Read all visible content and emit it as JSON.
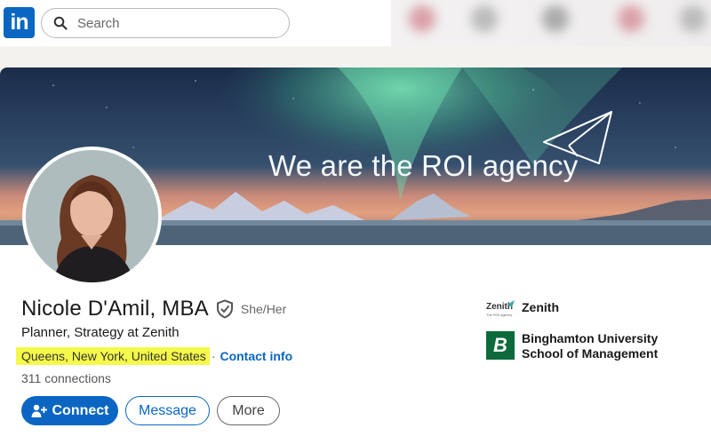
{
  "nav": {
    "logo_text": "in",
    "search_placeholder": "Search"
  },
  "banner": {
    "tagline": "We are the ROI agency"
  },
  "profile": {
    "name": "Nicole D'Amil, MBA",
    "pronouns": "She/Her",
    "headline": "Planner, Strategy at Zenith",
    "location": "Queens, New York, United States",
    "separator": "·",
    "contact_info": "Contact info",
    "connections": "311 connections"
  },
  "actions": {
    "connect": "Connect",
    "message": "Message",
    "more": "More"
  },
  "organizations": [
    {
      "name": "Zenith",
      "logo_text": "Zenith",
      "logo_subtext": "The ROI agency"
    },
    {
      "name": "Binghamton University School of Management",
      "logo_text": "B"
    }
  ],
  "colors": {
    "brand_blue": "#0a66c2",
    "highlight": "#f5f94a",
    "bu_green": "#0d6a3a"
  },
  "icons": [
    "search-icon",
    "verified-shield-icon",
    "add-person-icon",
    "paper-plane-icon"
  ]
}
